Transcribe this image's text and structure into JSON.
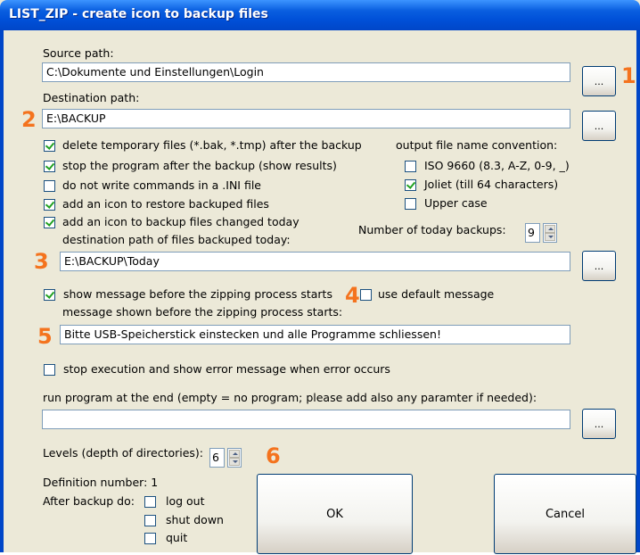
{
  "window": {
    "title": "LIST_ZIP - create icon to backup files"
  },
  "source": {
    "label": "Source path:",
    "value": "C:\\Dokumente und Einstellungen\\Login",
    "browse": "..."
  },
  "destination": {
    "label": "Destination path:",
    "value": "E:\\BACKUP",
    "browse": "..."
  },
  "options": [
    {
      "label": "delete temporary files (*.bak, *.tmp) after the backup",
      "checked": true
    },
    {
      "label": "stop the program after the backup (show results)",
      "checked": true
    },
    {
      "label": "do not write commands in a .INI file",
      "checked": false
    },
    {
      "label": "add an icon to restore backuped files",
      "checked": true
    },
    {
      "label": "add an icon to backup files changed today",
      "checked": true
    }
  ],
  "naming": {
    "label": "output file name convention:",
    "options": [
      {
        "label": "ISO 9660 (8.3, A-Z, 0-9, _)",
        "checked": false
      },
      {
        "label": "Joliet (till 64 characters)",
        "checked": true
      },
      {
        "label": "Upper case",
        "checked": false
      }
    ]
  },
  "today": {
    "path_label": "destination path of files backuped today:",
    "count_label": "Number of today backups:",
    "count": "9",
    "path": "E:\\BACKUP\\Today",
    "browse": "..."
  },
  "message": {
    "show_label": "show message before the zipping process starts",
    "show_checked": true,
    "default_label": "use default message",
    "default_checked": false,
    "text_label": "message shown before the zipping process starts:",
    "text": "Bitte USB-Speicherstick einstecken und alle Programme schliessen!"
  },
  "error": {
    "label": "stop execution and show error message when error occurs",
    "checked": false
  },
  "run_program": {
    "label": "run program at the end (empty = no program; please add also any paramter if needed):",
    "value": "",
    "browse": "..."
  },
  "levels": {
    "label": "Levels (depth of directories):",
    "value": "6"
  },
  "definition": {
    "label": "Definition number: 1"
  },
  "after_backup": {
    "label": "After backup do:",
    "options": [
      {
        "label": "log out",
        "checked": false
      },
      {
        "label": "shut down",
        "checked": false
      },
      {
        "label": "quit",
        "checked": false
      }
    ]
  },
  "buttons": {
    "ok": "OK",
    "cancel": "Cancel"
  },
  "markers": [
    "1",
    "2",
    "3",
    "4",
    "5",
    "6"
  ]
}
